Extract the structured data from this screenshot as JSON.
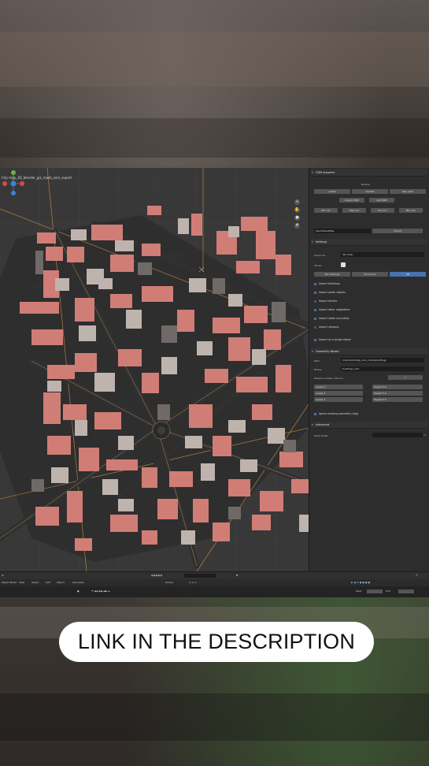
{
  "cta": {
    "label": "LINK IN THE DESCRIPTION"
  },
  "viewport": {
    "title": "City map_3D_blender_gis_roads_osm_export"
  },
  "panel": {
    "section_import": "OSM Importer",
    "browse": "Browse",
    "row_labels": [
      "Latest",
      "Update",
      "Map data"
    ],
    "download_labels": [
      "Import OSM",
      "Get OSM"
    ],
    "coord_labels": [
      "Min Lat",
      "Max Lat",
      "Min Lon",
      "Max Lon"
    ],
    "server": "OpenStreetMap",
    "import_btn": "Import",
    "section_settings": "Settings",
    "import_as_label": "Import as",
    "import_as_value": "3D mesh",
    "terrain_label": "Terrain",
    "mode_tabs": [
      "2D buildings",
      "3D terrain",
      "3D"
    ],
    "checkboxes": [
      {
        "label": "Import buildings",
        "checked": true
      },
      {
        "label": "Import water objects",
        "checked": true
      },
      {
        "label": "Import forests",
        "checked": false
      },
      {
        "label": "Import other vegetation",
        "checked": true
      },
      {
        "label": "Import roads and paths",
        "checked": true
      },
      {
        "label": "Import railways",
        "checked": false
      }
    ],
    "single_object": "Import as a single object",
    "section_geometry": "Geometry Nodes",
    "geo_rows": [
      {
        "label": "Path",
        "value": "//osm/buildings_osm_cache/buildings"
      },
      {
        "label": "Nodes",
        "value": "buildings_osm"
      }
    ],
    "default_floors_label": "Default number of floors",
    "floor_fields": [
      {
        "label": "Levels",
        "value": "3"
      },
      {
        "label": "Height",
        "value": "4.0"
      },
      {
        "label": "Levels",
        "value": "5"
      },
      {
        "label": "Height",
        "value": "3.0"
      },
      {
        "label": "Levels",
        "value": "2"
      },
      {
        "label": "Height",
        "value": "2.5"
      }
    ],
    "ignore_geometry": "Ignore existing geometry (tag)",
    "section_advanced": "Advanced",
    "temp_folder_label": "Temp folder"
  },
  "status": {
    "mode": "Object Mode",
    "menu": [
      "View",
      "Select",
      "Add",
      "Object",
      "Geometry"
    ],
    "transform": "Global",
    "frames": [
      "Start",
      "End",
      "1",
      "250"
    ]
  },
  "colors": {
    "roof": "#d07d76",
    "roof_light": "#bfb3ae",
    "road": "#343434",
    "block": "#2d2d2d",
    "accent": "#4772b3",
    "highlight": "#2ecc1f"
  }
}
